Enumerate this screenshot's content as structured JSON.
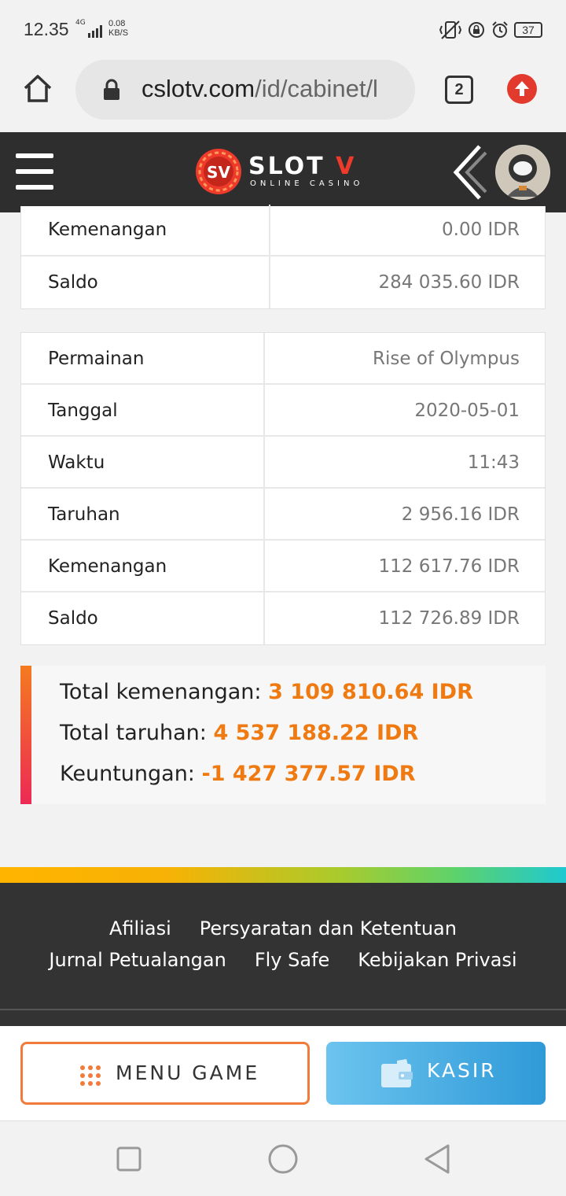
{
  "status_bar": {
    "time": "12.35",
    "network": "4G",
    "speed_value": "0.08",
    "speed_unit": "KB/S",
    "battery": "37"
  },
  "browser": {
    "url_host": "cslotv.com",
    "url_path": "/id/cabinet/l",
    "tab_count": "2"
  },
  "header": {
    "logo_main": "SLOT",
    "logo_v": "V",
    "logo_badge": "SV",
    "logo_sub": "ONLINE CASINO"
  },
  "table_top": {
    "rows": [
      {
        "label": "Kemenangan",
        "value": "0.00 IDR"
      },
      {
        "label": "Saldo",
        "value": "284 035.60 IDR"
      }
    ]
  },
  "table_main": {
    "rows": [
      {
        "label": "Permainan",
        "value": "Rise of Olympus"
      },
      {
        "label": "Tanggal",
        "value": "2020-05-01"
      },
      {
        "label": "Waktu",
        "value": "11:43"
      },
      {
        "label": "Taruhan",
        "value": "2 956.16 IDR"
      },
      {
        "label": "Kemenangan",
        "value": "112 617.76 IDR"
      },
      {
        "label": "Saldo",
        "value": "112 726.89 IDR"
      }
    ]
  },
  "summary": {
    "total_win_label": "Total kemenangan:",
    "total_win_value": "3 109 810.64 IDR",
    "total_bet_label": "Total taruhan:",
    "total_bet_value": "4 537 188.22 IDR",
    "profit_label": "Keuntungan:",
    "profit_value": "-1 427 377.57 IDR"
  },
  "footer": {
    "links_row1": [
      "Afiliasi",
      "Persyaratan dan Ketentuan"
    ],
    "links_row2": [
      "Jurnal Petualangan",
      "Fly Safe",
      "Kebijakan Privasi"
    ]
  },
  "buttons": {
    "menu_game": "MENU GAME",
    "kasir": "KASIR"
  },
  "colors": {
    "header_bg": "#2e2e2e",
    "accent_orange": "#ef7a12",
    "kasir_blue": "#2f9ad8",
    "brand_red": "#ee3a2a"
  }
}
